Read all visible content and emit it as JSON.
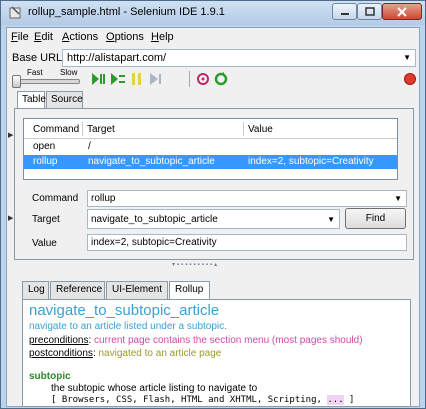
{
  "window": {
    "title": "rollup_sample.html - Selenium IDE 1.9.1"
  },
  "menu": [
    "File",
    "Edit",
    "Actions",
    "Options",
    "Help"
  ],
  "menu_access": [
    "F",
    "E",
    "A",
    "O",
    "H"
  ],
  "base_url": {
    "label": "Base URL",
    "value": "http://alistapart.com/"
  },
  "speed": {
    "fast": "Fast",
    "slow": "Slow",
    "level": 0
  },
  "tabs": [
    "Table",
    "Source"
  ],
  "table": {
    "headers": [
      "Command",
      "Target",
      "Value"
    ],
    "rows": [
      {
        "command": "open",
        "target": "/",
        "value": ""
      },
      {
        "command": "rollup",
        "target": "navigate_to_subtopic_article",
        "value": "index=2, subtopic=Creativity"
      }
    ]
  },
  "editor": {
    "command_label": "Command",
    "command_value": "rollup",
    "target_label": "Target",
    "target_value": "navigate_to_subtopic_article",
    "value_label": "Value",
    "value_value": "index=2, subtopic=Creativity",
    "find_label": "Find"
  },
  "bottom_tabs": [
    "Log",
    "Reference",
    "UI-Element",
    "Rollup"
  ],
  "doc": {
    "title": "navigate_to_subtopic_article",
    "description": "navigate to an article listed under a subtopic.",
    "preconditions_label": "preconditions",
    "preconditions": "current page contains the section menu (most pages should)",
    "postconditions_label": "postconditions",
    "postconditions": "navigated to an article page",
    "arg_name": "subtopic",
    "arg_desc": "the subtopic whose article listing to navigate to",
    "arg_values": "[ Browsers, CSS, Flash, HTML and XHTML, Scripting,",
    "arg_ellipsis": "...",
    "arg_close": "]"
  },
  "colors": {
    "selection": "#3399ff",
    "doc_title": "#3ca0d0",
    "pre": "#d14aa8",
    "post": "#9a9a2a",
    "arg": "#2a8a2a"
  }
}
